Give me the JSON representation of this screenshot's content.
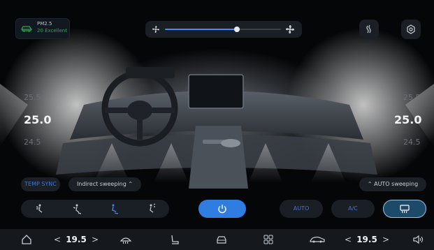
{
  "air_quality": {
    "label": "PM2.5",
    "value": "20  Excellent",
    "accent": "#2fa64f"
  },
  "fan": {
    "level": 0.62,
    "accent": "#3e8bff"
  },
  "driver_temp": {
    "above": "25.5",
    "current": "25.0",
    "below": "24.5"
  },
  "passenger_temp": {
    "above": "25.5",
    "current": "25.0",
    "below": "24.5"
  },
  "pills": {
    "temp_sync": "TEMP SYNC",
    "indirect_sweeping": "Indirect sweeping",
    "auto_sweeping": "AUTO sweeping"
  },
  "controls": {
    "auto": "AUTO",
    "ac": "A/C"
  },
  "dock": {
    "left_temp": "19.5",
    "right_temp": "19.5",
    "left_arrow": "<",
    "right_arrow": ">"
  }
}
